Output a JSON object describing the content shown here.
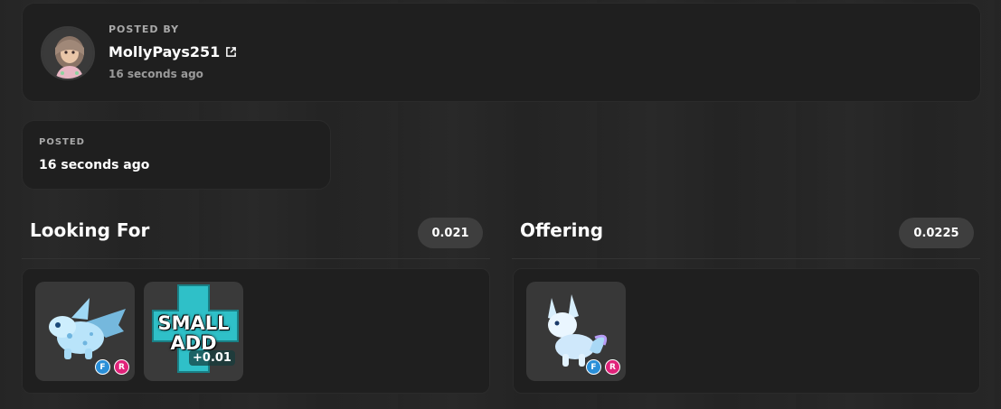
{
  "posted_by": {
    "label": "POSTED BY",
    "username": "MollyPays251",
    "time": "16 seconds ago",
    "avatar_icon": "avatar-icon",
    "link_icon": "external-link-icon"
  },
  "posted": {
    "label": "POSTED",
    "time": "16 seconds ago"
  },
  "looking_for": {
    "title": "Looking For",
    "value": "0.021",
    "items": [
      {
        "name": "frost-dragon-pet",
        "icon": "frost-dragon-icon",
        "badges": [
          "F",
          "R"
        ]
      },
      {
        "name": "small-add",
        "icon": "small-add-icon",
        "label_line1": "SMALL",
        "label_line2": "ADD",
        "add_value": "+0.01"
      }
    ]
  },
  "offering": {
    "title": "Offering",
    "value": "0.0225",
    "items": [
      {
        "name": "frost-fox-pet",
        "icon": "frost-fox-icon",
        "badges": [
          "F",
          "R"
        ]
      }
    ]
  },
  "colors": {
    "badge_f": "#2a8fd8",
    "badge_r": "#e0237a",
    "card_bg": "#1f1f1f",
    "pill_bg": "#3e3e3e"
  }
}
